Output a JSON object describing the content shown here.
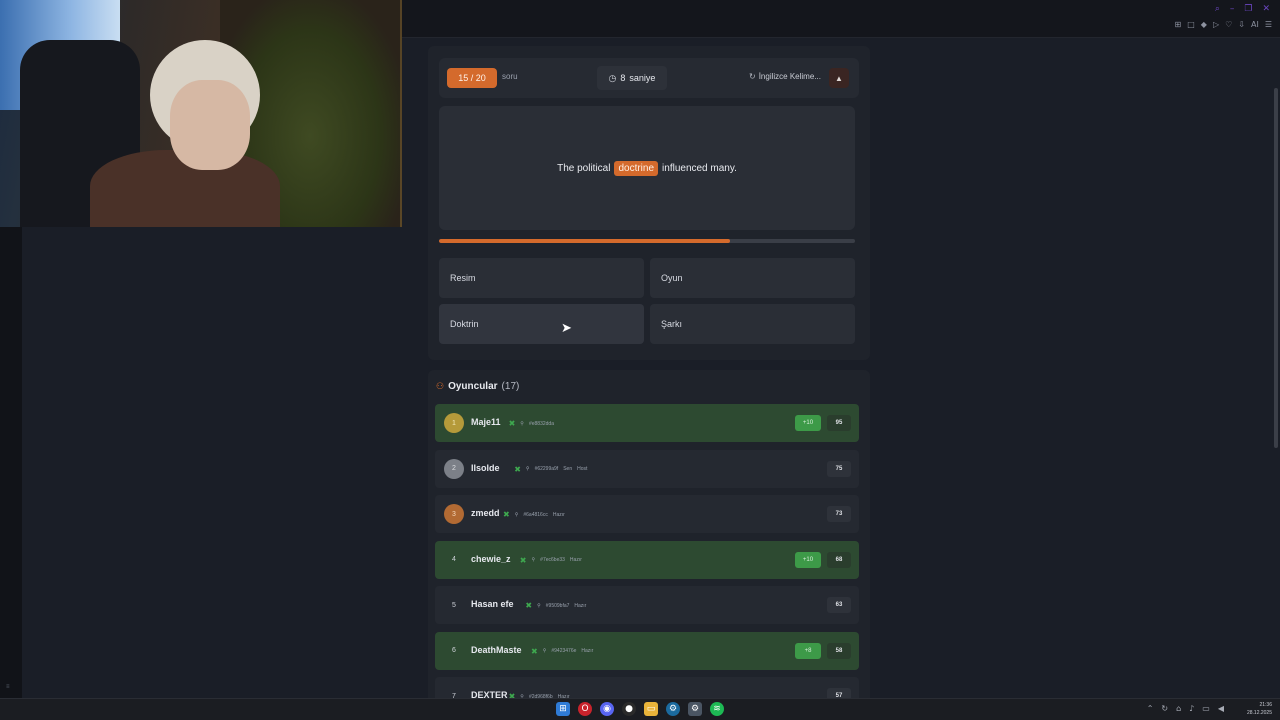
{
  "browser": {
    "toolbar_icons": [
      "pin-icon",
      "square-icon",
      "shield-icon",
      "play-icon",
      "heart-icon",
      "download-icon"
    ],
    "ai_label": "AI",
    "window_controls": [
      "⌕",
      "–",
      "❐",
      "✕"
    ]
  },
  "sidebar": {
    "bottom_text": "≡"
  },
  "quiz": {
    "counter": "15 / 20",
    "counter_label": "soru",
    "timer_value": "8",
    "timer_unit": "saniye",
    "category": "İngilizce Kelime...",
    "alert_symbol": "▲",
    "sentence_before": "The political",
    "sentence_word": "doctrine",
    "sentence_after": "influenced many.",
    "progress": 0.7,
    "options": [
      "Resim",
      "Oyun",
      "Doktrin",
      "Şarkı"
    ]
  },
  "players": {
    "title": "Oyuncular",
    "count": "(17)",
    "list": [
      {
        "rank": "1",
        "name": "Maje11",
        "id": "#e8832dda",
        "status": "",
        "plus": "+10",
        "score": "95"
      },
      {
        "rank": "2",
        "name": "IIsolde",
        "id": "#62299a9f",
        "status": "Sen",
        "status2": "Host",
        "plus": "",
        "score": "75"
      },
      {
        "rank": "3",
        "name": "zmedd",
        "id": "#6a4816cc",
        "status": "Hazır",
        "plus": "",
        "score": "73"
      },
      {
        "rank": "4",
        "name": "chewie_z",
        "id": "#7ec6be33",
        "status": "Hazır",
        "plus": "+10",
        "score": "68"
      },
      {
        "rank": "5",
        "name": "Hasan efe",
        "id": "#9509bfa7",
        "status": "Hazır",
        "plus": "",
        "score": "63"
      },
      {
        "rank": "6",
        "name": "DeathMaste",
        "id": "#9423476e",
        "status": "Hazır",
        "plus": "+8",
        "score": "58"
      },
      {
        "rank": "7",
        "name": "DEXTER",
        "id": "#2d968f6b",
        "status": "Hazır",
        "plus": "",
        "score": "57"
      }
    ]
  },
  "taskbar": {
    "time": "21:36",
    "date": "28.12.2025"
  },
  "colors": {
    "accent": "#d46a2c",
    "correct_row": "#2d4a31",
    "plus_badge": "#3d9a48"
  }
}
